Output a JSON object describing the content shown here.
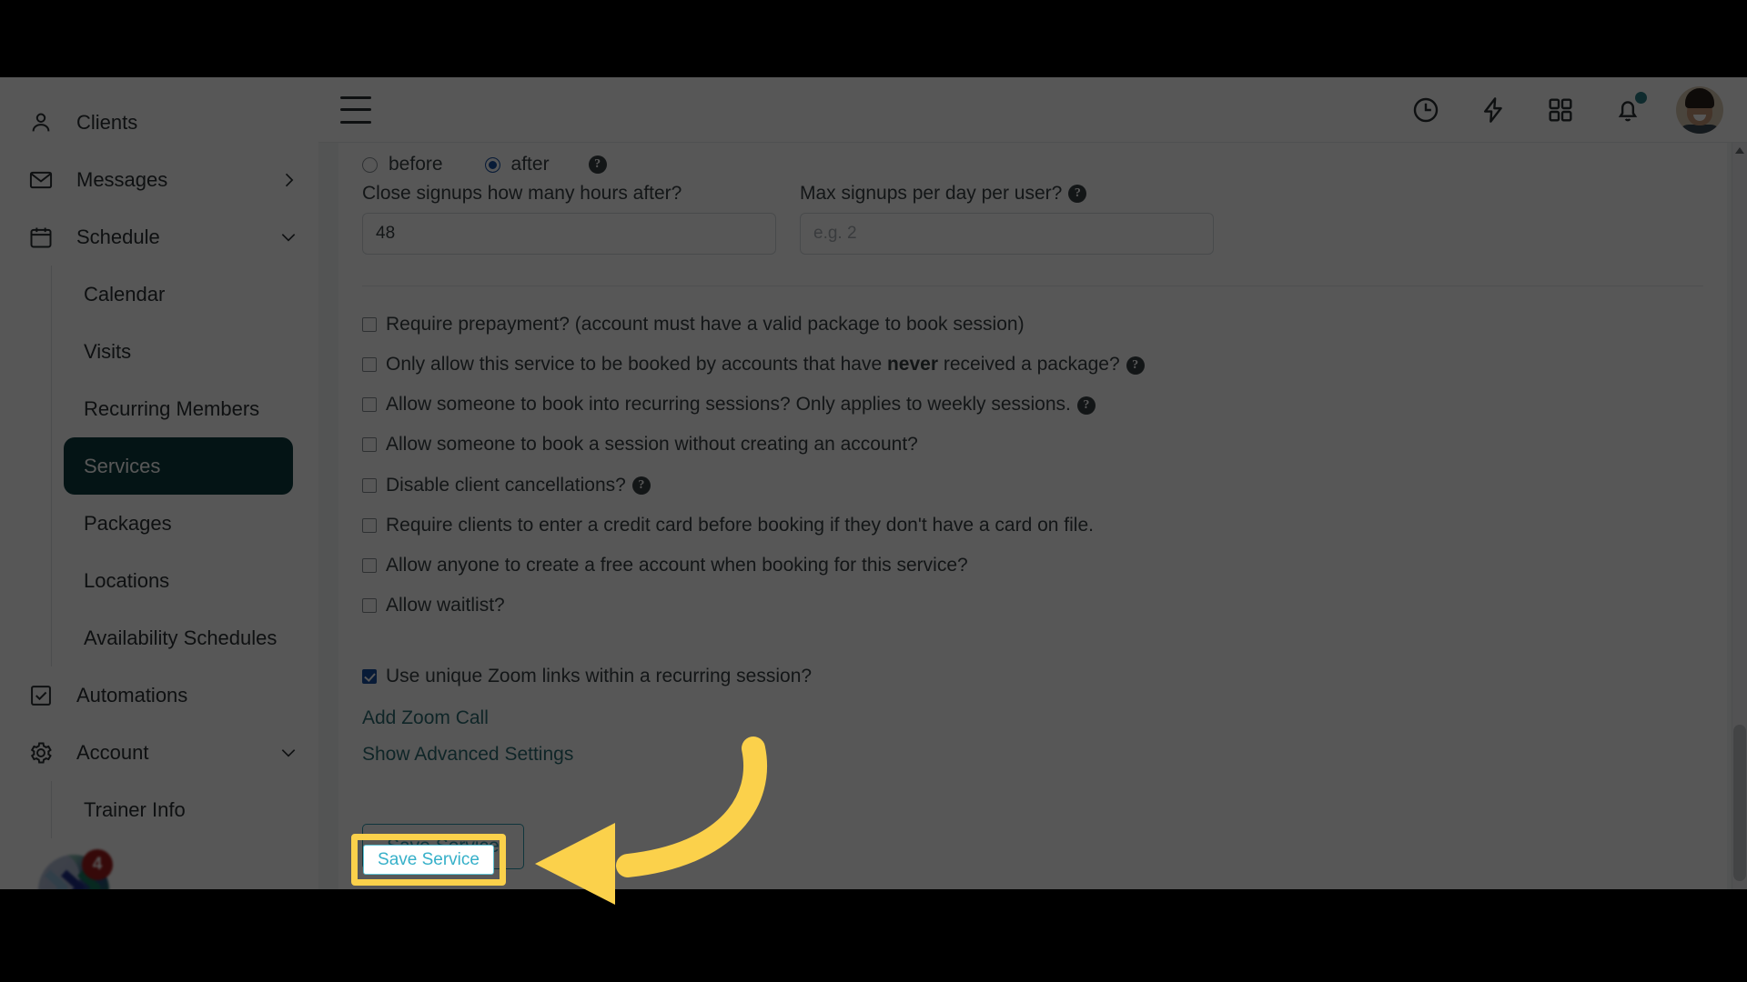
{
  "sidebar": {
    "items": [
      {
        "label": "Clients",
        "icon": "person-icon",
        "chevron": ""
      },
      {
        "label": "Messages",
        "icon": "envelope-icon",
        "chevron": "right"
      },
      {
        "label": "Schedule",
        "icon": "calendar-icon",
        "chevron": "down"
      }
    ],
    "subitems": [
      {
        "label": "Calendar",
        "active": false
      },
      {
        "label": "Visits",
        "active": false
      },
      {
        "label": "Recurring Members",
        "active": false
      },
      {
        "label": "Services",
        "active": true
      },
      {
        "label": "Packages",
        "active": false
      },
      {
        "label": "Locations",
        "active": false
      },
      {
        "label": "Availability Schedules",
        "active": false
      }
    ],
    "lower_items": [
      {
        "label": "Automations",
        "icon": "checkbox-square-icon",
        "chevron": ""
      },
      {
        "label": "Account",
        "icon": "gear-icon",
        "chevron": "down"
      }
    ],
    "lower_subitems": [
      {
        "label": "Trainer Info",
        "active": false
      }
    ],
    "app_bubble_badge": "4"
  },
  "topbar": {
    "menu_icon": "hamburger-icon",
    "icons": [
      {
        "name": "clock-icon"
      },
      {
        "name": "lightning-bolt-icon"
      },
      {
        "name": "apps-grid-icon"
      },
      {
        "name": "bell-icon",
        "badge_dot": true
      }
    ],
    "avatar_alt": "user-avatar"
  },
  "form": {
    "timing": {
      "before_label": "before",
      "after_label": "after",
      "selected": "after",
      "help_icon": "help-icon"
    },
    "fields": [
      {
        "label": "Close signups how many hours after?",
        "value": "48",
        "placeholder": "",
        "help": false
      },
      {
        "label": "Max signups per day per user?",
        "value": "",
        "placeholder": "e.g. 2",
        "help": true
      }
    ],
    "checkboxes": [
      {
        "text": "Require prepayment? (account must have a valid package to book session)",
        "checked": false,
        "help": false
      },
      {
        "pre": "Only allow this service to be booked by accounts that have ",
        "bold": "never",
        "post": " received a package?",
        "checked": false,
        "help": true
      },
      {
        "text": "Allow someone to book into recurring sessions? Only applies to weekly sessions.",
        "checked": false,
        "help": true
      },
      {
        "text": "Allow someone to book a session without creating an account?",
        "checked": false,
        "help": false
      },
      {
        "text": "Disable client cancellations?",
        "checked": false,
        "help": true
      },
      {
        "text": "Require clients to enter a credit card before booking if they don't have a card on file.",
        "checked": false,
        "help": false
      },
      {
        "text": "Allow anyone to create a free account when booking for this service?",
        "checked": false,
        "help": false
      },
      {
        "text": "Allow waitlist?",
        "checked": false,
        "help": false
      }
    ],
    "zoom_section": {
      "checkbox_label": "Use unique Zoom links within a recurring session?",
      "checkbox_checked": true,
      "add_zoom_call_link": "Add Zoom Call",
      "advanced_settings_link": "Show Advanced Settings"
    },
    "save_label": "Save Service"
  },
  "colors": {
    "sidebar_active_bg": "#0e3b3e",
    "link_teal": "#2e6d74",
    "save_button_text": "#36b0c9",
    "annotation_yellow": "#fbd14b",
    "badge_red": "#9e1b1b",
    "bell_dot_teal": "#2e7f86",
    "radio_blue": "#1a4fa0"
  }
}
